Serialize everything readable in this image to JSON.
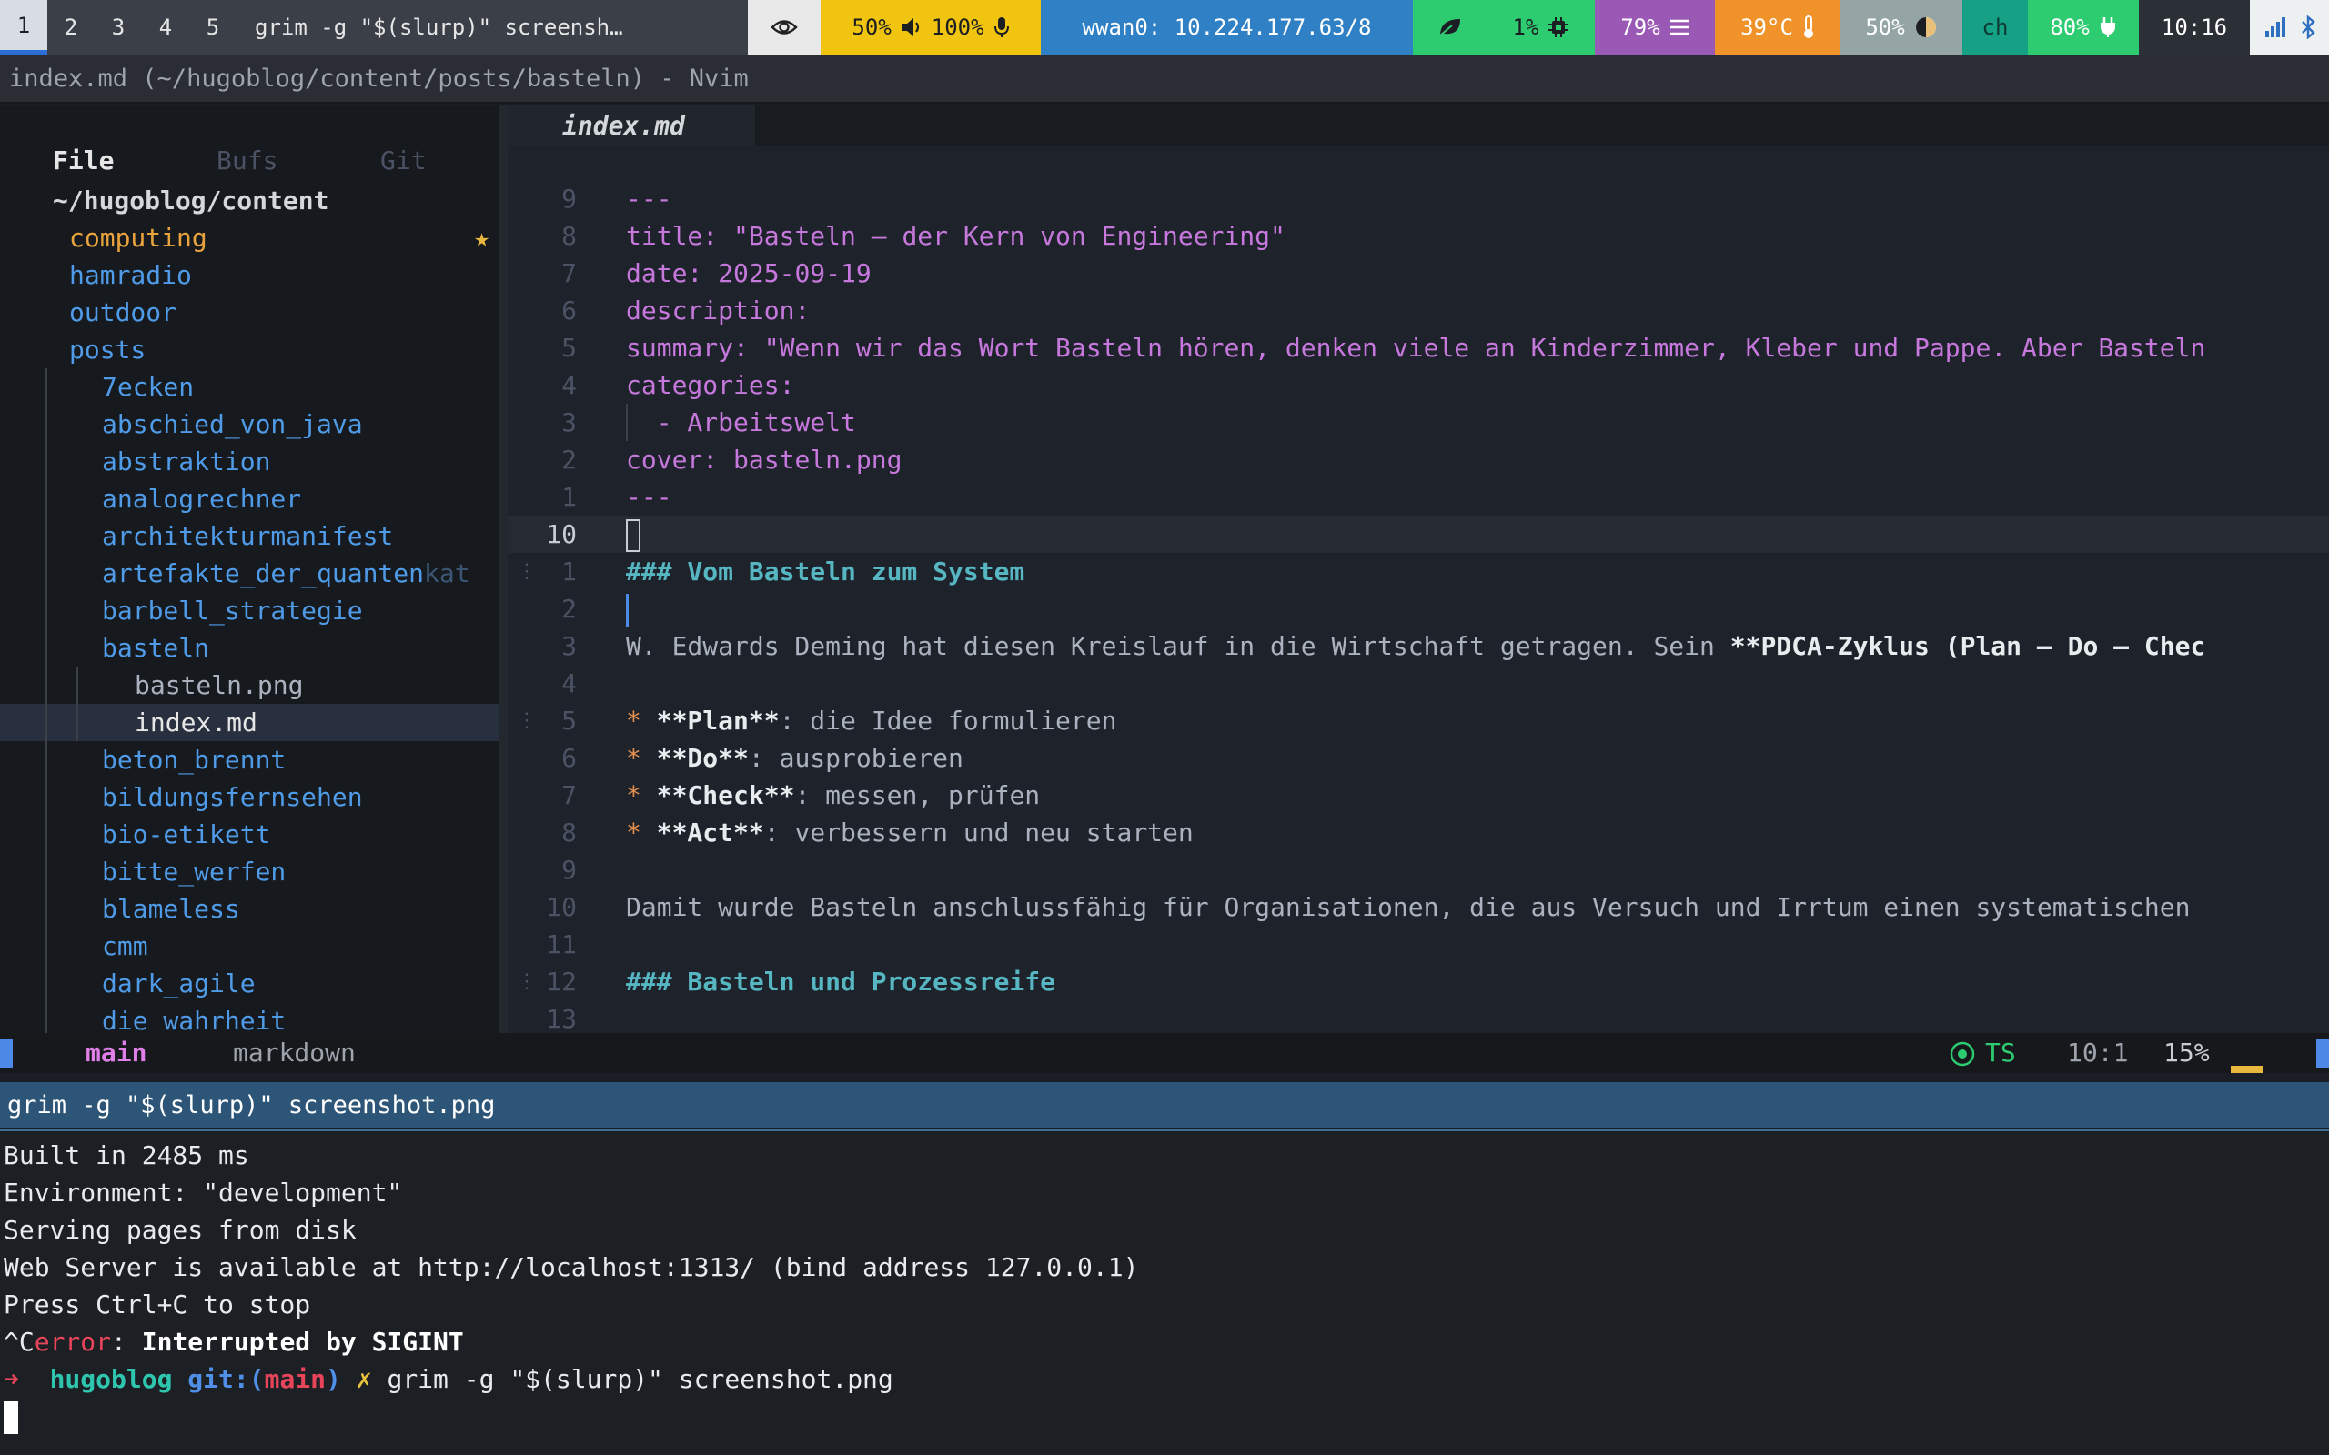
{
  "bar": {
    "workspaces": [
      "1",
      "2",
      "3",
      "4",
      "5"
    ],
    "active_workspace": "1",
    "window_title": "grim -g \"$(slurp)\" screensh…",
    "audio": {
      "volume": "50%",
      "mic": "100%"
    },
    "network": "wwan0: 10.224.177.63/8",
    "cpu": "1%",
    "memory": "79%",
    "temperature": "39°C",
    "brightness": "50%",
    "language": "ch",
    "battery": "80%",
    "clock": "10:16"
  },
  "nvim": {
    "title": "index.md (~/hugoblog/content/posts/basteln) - Nvim",
    "buffer_tab": "index.md"
  },
  "sidebar": {
    "tabs": [
      "File",
      "Bufs",
      "Git"
    ],
    "root": "~/hugoblog/content",
    "items": [
      {
        "name": "computing"
      },
      {
        "name": "hamradio"
      },
      {
        "name": "outdoor"
      },
      {
        "name": "posts"
      },
      {
        "name": "7ecken"
      },
      {
        "name": "abschied_von_java"
      },
      {
        "name": "abstraktion"
      },
      {
        "name": "analogrechner"
      },
      {
        "name": "architekturmanifest"
      },
      {
        "name": "artefakte_der_quanten",
        "tail": "kat"
      },
      {
        "name": "barbell_strategie"
      },
      {
        "name": "basteln"
      },
      {
        "name": "basteln.png"
      },
      {
        "name": "index.md"
      },
      {
        "name": "beton_brennt"
      },
      {
        "name": "bildungsfernsehen"
      },
      {
        "name": "bio-etikett"
      },
      {
        "name": "bitte_werfen"
      },
      {
        "name": "blameless"
      },
      {
        "name": "cmm"
      },
      {
        "name": "dark_agile"
      },
      {
        "name": "die_wahrheit"
      }
    ]
  },
  "editor": {
    "lines": [
      {
        "n": "9",
        "text": "---"
      },
      {
        "n": "8",
        "key": "title: ",
        "val": "\"Basteln – der Kern von Engineering\""
      },
      {
        "n": "7",
        "key": "date: ",
        "val": "2025-09-19"
      },
      {
        "n": "6",
        "key": "description:",
        "val": ""
      },
      {
        "n": "5",
        "key": "summary: ",
        "val": "\"Wenn wir das Wort Basteln hören, denken viele an Kinderzimmer, Kleber und Pappe. Aber Basteln"
      },
      {
        "n": "4",
        "key": "categories:",
        "val": ""
      },
      {
        "n": "3",
        "text": "  - Arbeitswelt"
      },
      {
        "n": "2",
        "key": "cover: ",
        "val": "basteln.png"
      },
      {
        "n": "1",
        "text": "---"
      },
      {
        "n": "10",
        "text": ""
      },
      {
        "n": "1",
        "heading": "### Vom Basteln zum System"
      },
      {
        "n": "2",
        "text": ""
      },
      {
        "n": "3",
        "pre": "W. Edwards Deming hat diesen Kreislauf in die Wirtschaft getragen. Sein ",
        "bold": "**PDCA-Zyklus (Plan – Do – Chec"
      },
      {
        "n": "4",
        "text": ""
      },
      {
        "n": "5",
        "bullet": "* ",
        "bold": "**Plan**",
        "rest": ": die Idee formulieren"
      },
      {
        "n": "6",
        "bullet": "* ",
        "bold": "**Do**",
        "rest": ": ausprobieren"
      },
      {
        "n": "7",
        "bullet": "* ",
        "bold": "**Check**",
        "rest": ": messen, prüfen"
      },
      {
        "n": "8",
        "bullet": "* ",
        "bold": "**Act**",
        "rest": ": verbessern und neu starten"
      },
      {
        "n": "9",
        "text": ""
      },
      {
        "n": "10",
        "text": "Damit wurde Basteln anschlussfähig für Organisationen, die aus Versuch und Irrtum einen systematischen"
      },
      {
        "n": "11",
        "text": ""
      },
      {
        "n": "12",
        "heading": "### Basteln und Prozessreife"
      },
      {
        "n": "13",
        "text": ""
      }
    ]
  },
  "statusline": {
    "branch": "main",
    "filetype": "markdown",
    "ts": "TS",
    "position": "10:1",
    "percent": "15%"
  },
  "terminal": {
    "title": "grim -g \"$(slurp)\" screenshot.png",
    "output": [
      "Built in 2485 ms",
      "Environment: \"development\"",
      "Serving pages from disk",
      "Web Server is available at http://localhost:1313/ (bind address 127.0.0.1)",
      "Press Ctrl+C to stop"
    ],
    "error_prefix": "^C",
    "error_word": "error",
    "error_msg": ": ",
    "error_detail": "Interrupted by SIGINT",
    "prompt": {
      "arrow": "➜",
      "dir": "hugoblog",
      "git_label": "git:(",
      "branch": "main",
      "git_close": ")",
      "dirty": "✗",
      "command": "grim -g \"$(slurp)\" screenshot.png"
    }
  }
}
